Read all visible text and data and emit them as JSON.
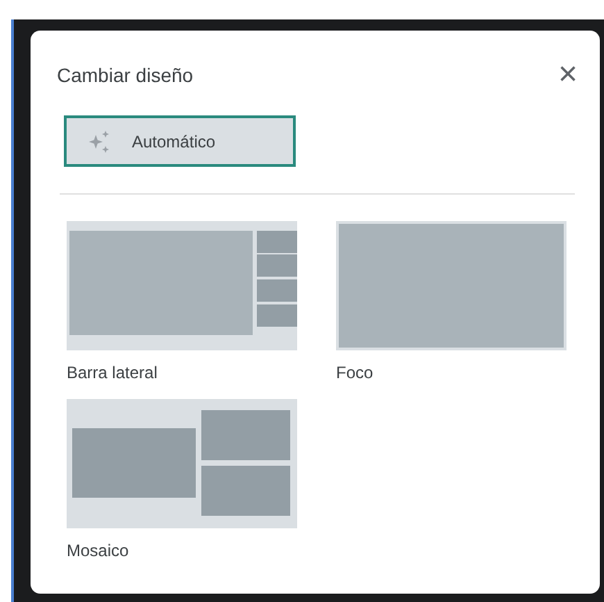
{
  "dialog": {
    "title": "Cambiar diseño",
    "close": "×"
  },
  "auto_option": {
    "label": "Automático",
    "selected": true
  },
  "layouts": [
    {
      "kind": "sidebar",
      "label": "Barra lateral",
      "selected": false
    },
    {
      "kind": "spotlight",
      "label": "Foco",
      "selected": false
    },
    {
      "kind": "tiled",
      "label": "Mosaico",
      "selected": false
    }
  ]
}
